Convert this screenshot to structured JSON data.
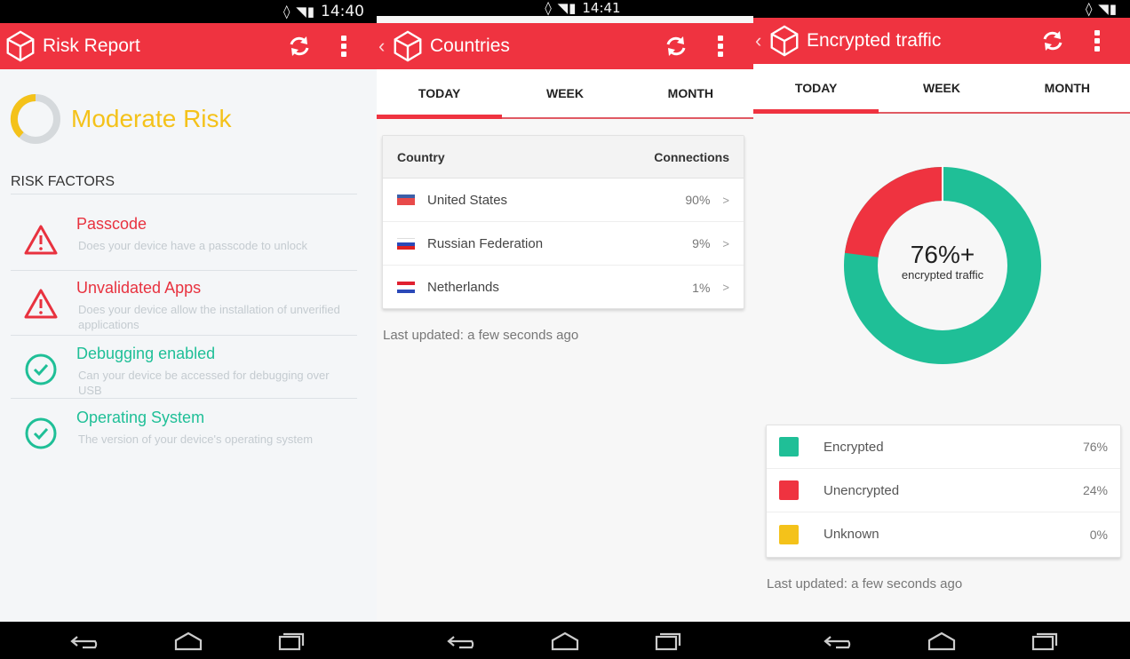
{
  "colors": {
    "accent": "#ef3340",
    "good": "#1fbf97",
    "warn": "#f4c21a",
    "encrypted": "#1fbf97",
    "unencrypted": "#ef3340",
    "unknown": "#f4c21a"
  },
  "screen1": {
    "status_time": "14:40",
    "title": "Risk Report",
    "risk_level": "Moderate Risk",
    "risk_factors_heading": "RISK FACTORS",
    "factors": [
      {
        "name": "Passcode",
        "description": "Does your device have a passcode to unlock",
        "status": "warning-icon"
      },
      {
        "name": "Unvalidated Apps",
        "description": "Does your device allow the installation of unverified applications",
        "status": "warning-icon"
      },
      {
        "name": "Debugging enabled",
        "description": "Can your device be accessed for debugging over USB",
        "status": "check-icon"
      },
      {
        "name": "Operating System",
        "description": "The version of your device's operating system",
        "status": "check-icon"
      }
    ]
  },
  "screen2": {
    "status_time": "14:41",
    "title": "Countries",
    "tabs": [
      "TODAY",
      "WEEK",
      "MONTH"
    ],
    "active_tab": "TODAY",
    "table": {
      "col_country": "Country",
      "col_connections": "Connections",
      "rows": [
        {
          "country": "United States",
          "connections": "90%",
          "chevron": ">"
        },
        {
          "country": "Russian Federation",
          "connections": "9%",
          "chevron": ">"
        },
        {
          "country": "Netherlands",
          "connections": "1%",
          "chevron": ">"
        }
      ]
    },
    "last_updated": "Last updated: a few seconds ago"
  },
  "screen3": {
    "title": "Encrypted traffic",
    "tabs": [
      "TODAY",
      "WEEK",
      "MONTH"
    ],
    "active_tab": "TODAY",
    "donut_value": "76%+",
    "donut_label": "encrypted traffic",
    "legend": [
      {
        "name": "Encrypted",
        "value": "76%"
      },
      {
        "name": "Unencrypted",
        "value": "24%"
      },
      {
        "name": "Unknown",
        "value": "0%"
      }
    ],
    "last_updated": "Last updated: a few seconds ago"
  }
}
